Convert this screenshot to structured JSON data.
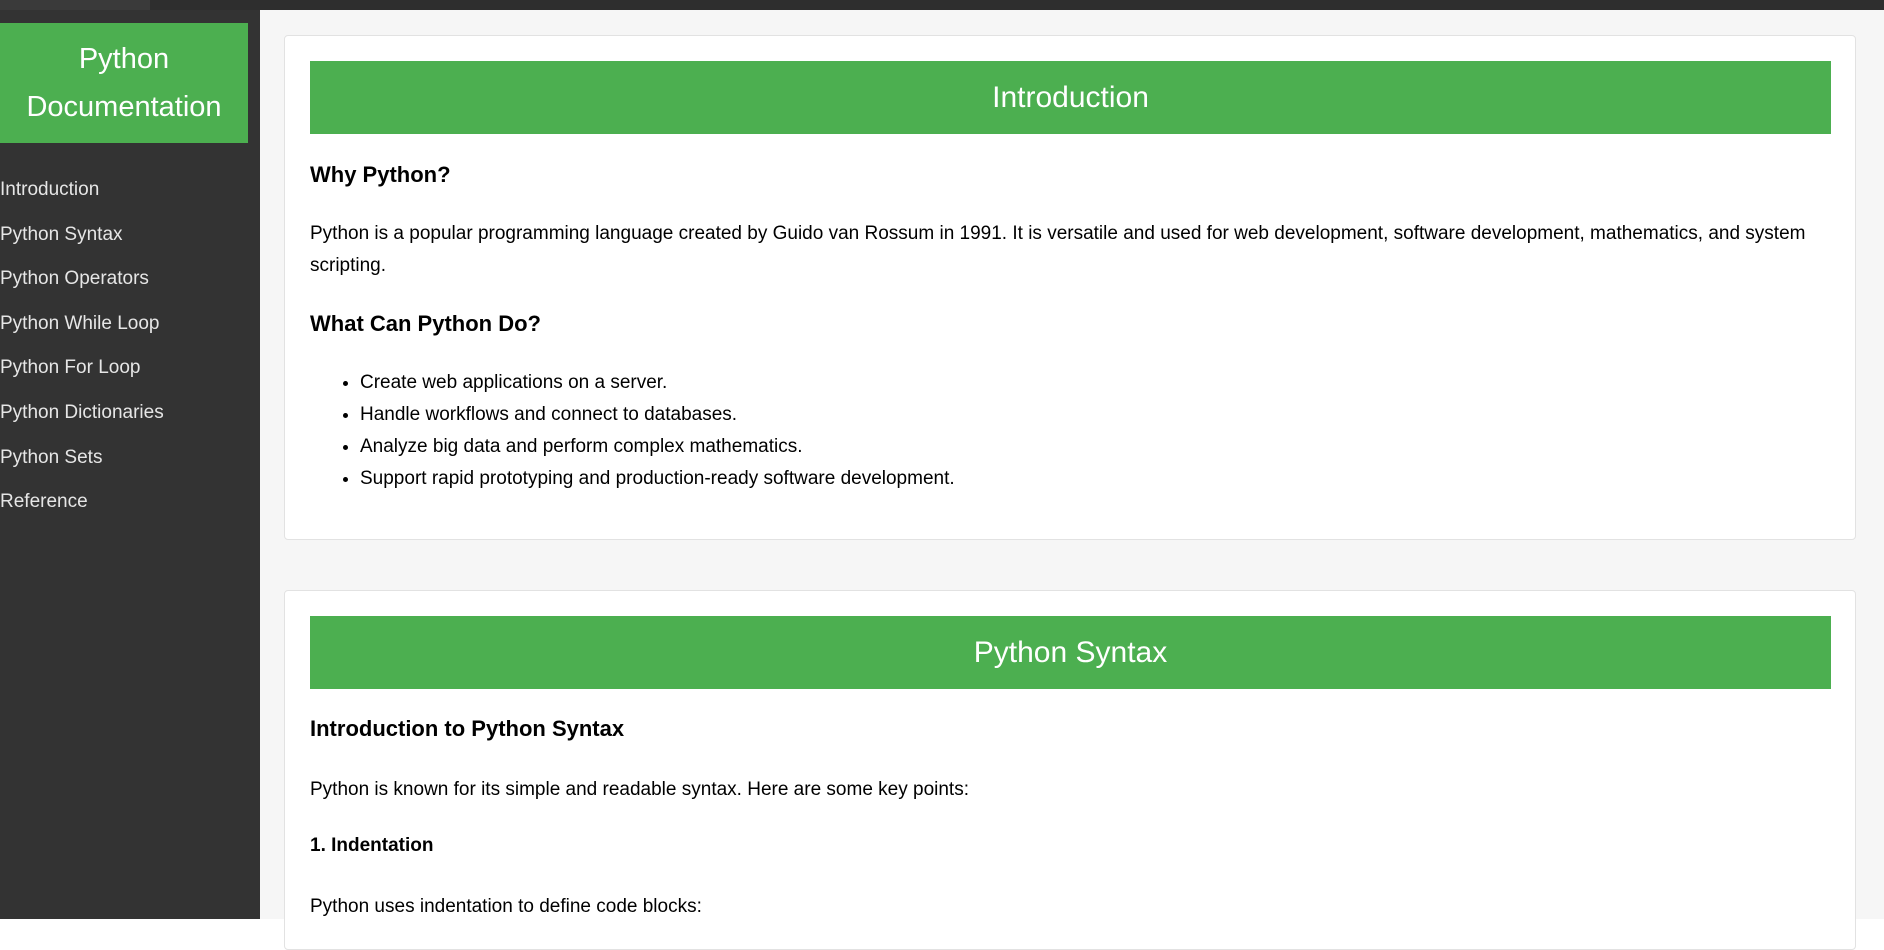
{
  "sidebar": {
    "title": "Python Documentation",
    "items": [
      {
        "label": "Introduction"
      },
      {
        "label": "Python Syntax"
      },
      {
        "label": "Python Operators"
      },
      {
        "label": "Python While Loop"
      },
      {
        "label": "Python For Loop"
      },
      {
        "label": "Python Dictionaries"
      },
      {
        "label": "Python Sets"
      },
      {
        "label": "Reference"
      }
    ]
  },
  "sections": [
    {
      "title": "Introduction",
      "heading1": "Why Python?",
      "paragraph1": "Python is a popular programming language created by Guido van Rossum in 1991. It is versatile and used for web development, software development, mathematics, and system scripting.",
      "heading2": "What Can Python Do?",
      "list": [
        "Create web applications on a server.",
        "Handle workflows and connect to databases.",
        "Analyze big data and perform complex mathematics.",
        "Support rapid prototyping and production-ready software development."
      ]
    },
    {
      "title": "Python Syntax",
      "heading1": "Introduction to Python Syntax",
      "paragraph1": "Python is known for its simple and readable syntax. Here are some key points:",
      "subheading": "1. Indentation",
      "paragraph2": "Python uses indentation to define code blocks:"
    }
  ],
  "colors": {
    "accent": "#4caf50",
    "sidebar_bg": "#333333"
  }
}
